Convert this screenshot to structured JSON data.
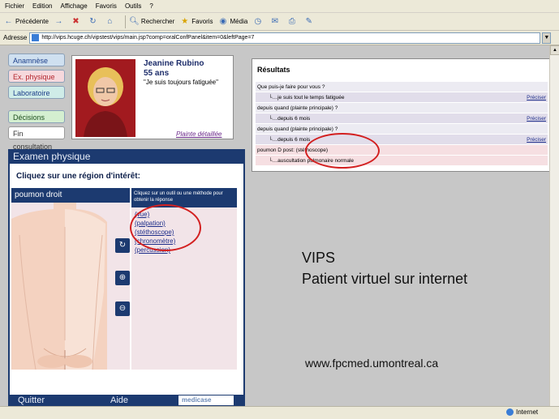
{
  "browser": {
    "menu": [
      "Fichier",
      "Edition",
      "Affichage",
      "Favoris",
      "Outils",
      "?"
    ],
    "toolbar": {
      "back": "Précédente",
      "search": "Rechercher",
      "favorites": "Favoris",
      "media": "Média"
    },
    "address_label": "Adresse",
    "address_url": "http://vips.hcuge.ch/vipstest/vips/main.jsp?comp=oralConfPanel&item=0&leftPage=7",
    "status_zone": "Internet"
  },
  "nav": {
    "items": [
      "Anamnèse",
      "Ex. physique",
      "Laboratoire",
      "Décisions",
      "Fin consultation"
    ]
  },
  "patient": {
    "name": "Jeanine Rubino",
    "age": "55 ans",
    "quote": "\"Je suis toujours fatiguée\"",
    "detail_link": "Plainte détaillée"
  },
  "exam": {
    "title": "Examen physique",
    "prompt": "Cliquez sur une région d'intérêt:",
    "region": "poumon droit",
    "tools_header": "Cliquez sur un outil ou une méthode pour obtenir la réponse",
    "tools": [
      "(vue)",
      "(palpation)",
      "(stéthoscope)",
      "(chronomètre)",
      "(percussion)"
    ],
    "quit_label": "Quitter",
    "help_label": "Aide",
    "logo": "medicase"
  },
  "results": {
    "title": "Résultats",
    "rows": [
      {
        "kind": "q",
        "text": "Que puis-je faire pour vous ?",
        "action": ""
      },
      {
        "kind": "a",
        "text": "je suis tout le temps fatiguée",
        "action": "Préciser"
      },
      {
        "kind": "q",
        "text": "depuis quand (plainte principale) ?",
        "action": ""
      },
      {
        "kind": "a",
        "text": "depuis 6 mois",
        "action": "Préciser"
      },
      {
        "kind": "q",
        "text": "depuis quand (plainte principale) ?",
        "action": ""
      },
      {
        "kind": "a",
        "text": "depuis 6 mois",
        "action": "Préciser"
      },
      {
        "kind": "pink",
        "text": "poumon D post: (stéthoscope)",
        "action": ""
      },
      {
        "kind": "pink-a",
        "text": "auscultation pulmonaire normale",
        "action": ""
      }
    ]
  },
  "overlay": {
    "title": "VIPS",
    "subtitle": "Patient virtuel sur internet",
    "website": "www.fpcmed.umontreal.ca"
  }
}
